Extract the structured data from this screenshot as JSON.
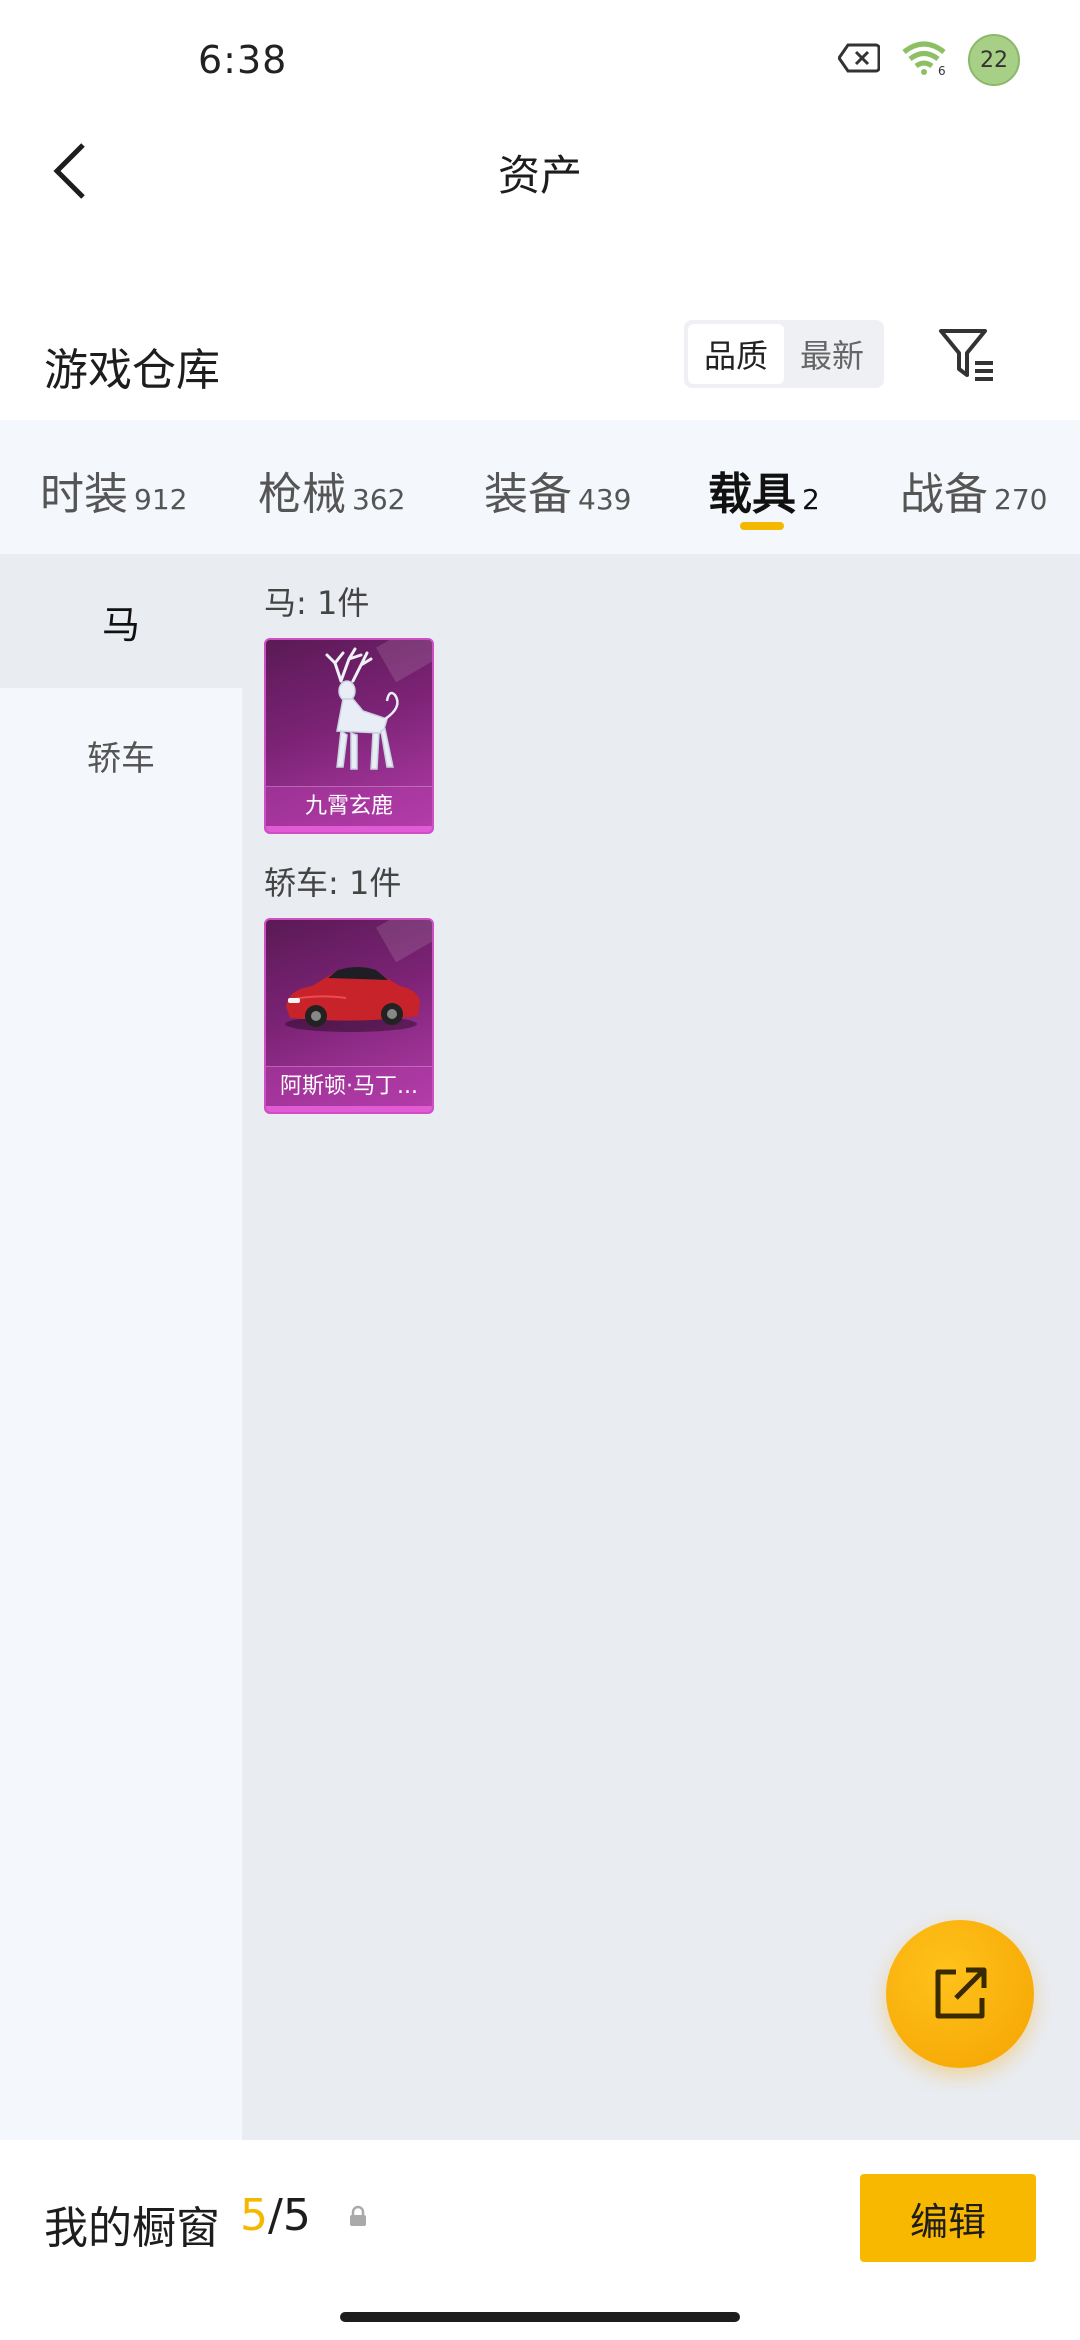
{
  "status_bar": {
    "time": "6:38",
    "battery_level": "22",
    "icons": [
      "sim-error-icon",
      "wifi-icon",
      "battery-icon"
    ]
  },
  "header": {
    "title": "资产",
    "back_icon": "chevron-left-icon"
  },
  "warehouse": {
    "title": "游戏仓库",
    "sort_options": [
      {
        "label": "品质",
        "active": true
      },
      {
        "label": "最新",
        "active": false
      }
    ],
    "filter_icon": "filter-icon"
  },
  "tabs": [
    {
      "label": "时装",
      "count": "912",
      "active": false
    },
    {
      "label": "枪械",
      "count": "362",
      "active": false
    },
    {
      "label": "装备",
      "count": "439",
      "active": false
    },
    {
      "label": "载具",
      "count": "2",
      "active": true
    },
    {
      "label": "战备",
      "count": "270",
      "active": false
    }
  ],
  "side_nav": [
    {
      "label": "马",
      "active": true
    },
    {
      "label": "轿车",
      "active": false
    }
  ],
  "groups": [
    {
      "title": "马: 1件",
      "items": [
        {
          "name": "九霄玄鹿",
          "image": "deer-icon"
        }
      ]
    },
    {
      "title": "轿车: 1件",
      "items": [
        {
          "name": "阿斯顿·马丁...",
          "image": "car-icon"
        }
      ]
    }
  ],
  "fab": {
    "icon": "share-external-icon"
  },
  "bottom_bar": {
    "label": "我的橱窗",
    "current": "5",
    "separator": "/",
    "total": "5",
    "lock_icon": "lock-icon",
    "edit_label": "编辑"
  },
  "colors": {
    "accent": "#f5b800",
    "card_purple": "#7d2377",
    "tab_bg": "#f4f7fb",
    "content_bg": "#e9ecf1"
  }
}
